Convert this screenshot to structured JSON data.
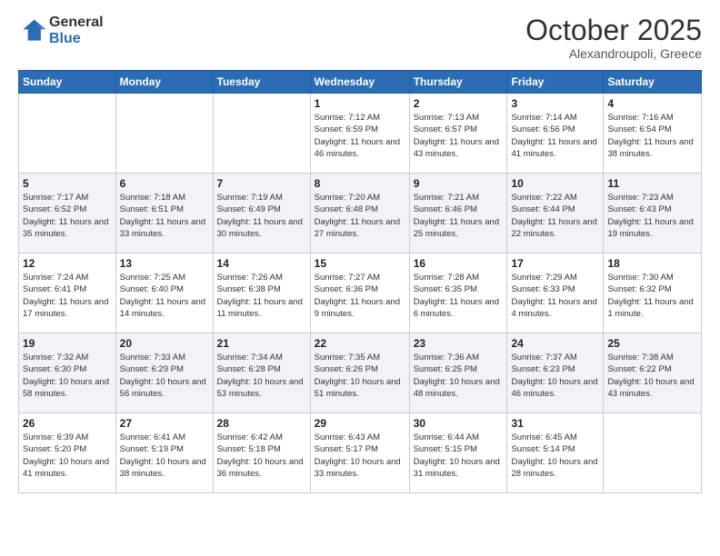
{
  "header": {
    "logo_general": "General",
    "logo_blue": "Blue",
    "month": "October 2025",
    "location": "Alexandroupoli, Greece"
  },
  "weekdays": [
    "Sunday",
    "Monday",
    "Tuesday",
    "Wednesday",
    "Thursday",
    "Friday",
    "Saturday"
  ],
  "weeks": [
    [
      {
        "day": "",
        "info": ""
      },
      {
        "day": "",
        "info": ""
      },
      {
        "day": "",
        "info": ""
      },
      {
        "day": "1",
        "info": "Sunrise: 7:12 AM\nSunset: 6:59 PM\nDaylight: 11 hours and 46 minutes."
      },
      {
        "day": "2",
        "info": "Sunrise: 7:13 AM\nSunset: 6:57 PM\nDaylight: 11 hours and 43 minutes."
      },
      {
        "day": "3",
        "info": "Sunrise: 7:14 AM\nSunset: 6:56 PM\nDaylight: 11 hours and 41 minutes."
      },
      {
        "day": "4",
        "info": "Sunrise: 7:16 AM\nSunset: 6:54 PM\nDaylight: 11 hours and 38 minutes."
      }
    ],
    [
      {
        "day": "5",
        "info": "Sunrise: 7:17 AM\nSunset: 6:52 PM\nDaylight: 11 hours and 35 minutes."
      },
      {
        "day": "6",
        "info": "Sunrise: 7:18 AM\nSunset: 6:51 PM\nDaylight: 11 hours and 33 minutes."
      },
      {
        "day": "7",
        "info": "Sunrise: 7:19 AM\nSunset: 6:49 PM\nDaylight: 11 hours and 30 minutes."
      },
      {
        "day": "8",
        "info": "Sunrise: 7:20 AM\nSunset: 6:48 PM\nDaylight: 11 hours and 27 minutes."
      },
      {
        "day": "9",
        "info": "Sunrise: 7:21 AM\nSunset: 6:46 PM\nDaylight: 11 hours and 25 minutes."
      },
      {
        "day": "10",
        "info": "Sunrise: 7:22 AM\nSunset: 6:44 PM\nDaylight: 11 hours and 22 minutes."
      },
      {
        "day": "11",
        "info": "Sunrise: 7:23 AM\nSunset: 6:43 PM\nDaylight: 11 hours and 19 minutes."
      }
    ],
    [
      {
        "day": "12",
        "info": "Sunrise: 7:24 AM\nSunset: 6:41 PM\nDaylight: 11 hours and 17 minutes."
      },
      {
        "day": "13",
        "info": "Sunrise: 7:25 AM\nSunset: 6:40 PM\nDaylight: 11 hours and 14 minutes."
      },
      {
        "day": "14",
        "info": "Sunrise: 7:26 AM\nSunset: 6:38 PM\nDaylight: 11 hours and 11 minutes."
      },
      {
        "day": "15",
        "info": "Sunrise: 7:27 AM\nSunset: 6:36 PM\nDaylight: 11 hours and 9 minutes."
      },
      {
        "day": "16",
        "info": "Sunrise: 7:28 AM\nSunset: 6:35 PM\nDaylight: 11 hours and 6 minutes."
      },
      {
        "day": "17",
        "info": "Sunrise: 7:29 AM\nSunset: 6:33 PM\nDaylight: 11 hours and 4 minutes."
      },
      {
        "day": "18",
        "info": "Sunrise: 7:30 AM\nSunset: 6:32 PM\nDaylight: 11 hours and 1 minute."
      }
    ],
    [
      {
        "day": "19",
        "info": "Sunrise: 7:32 AM\nSunset: 6:30 PM\nDaylight: 10 hours and 58 minutes."
      },
      {
        "day": "20",
        "info": "Sunrise: 7:33 AM\nSunset: 6:29 PM\nDaylight: 10 hours and 56 minutes."
      },
      {
        "day": "21",
        "info": "Sunrise: 7:34 AM\nSunset: 6:28 PM\nDaylight: 10 hours and 53 minutes."
      },
      {
        "day": "22",
        "info": "Sunrise: 7:35 AM\nSunset: 6:26 PM\nDaylight: 10 hours and 51 minutes."
      },
      {
        "day": "23",
        "info": "Sunrise: 7:36 AM\nSunset: 6:25 PM\nDaylight: 10 hours and 48 minutes."
      },
      {
        "day": "24",
        "info": "Sunrise: 7:37 AM\nSunset: 6:23 PM\nDaylight: 10 hours and 46 minutes."
      },
      {
        "day": "25",
        "info": "Sunrise: 7:38 AM\nSunset: 6:22 PM\nDaylight: 10 hours and 43 minutes."
      }
    ],
    [
      {
        "day": "26",
        "info": "Sunrise: 6:39 AM\nSunset: 5:20 PM\nDaylight: 10 hours and 41 minutes."
      },
      {
        "day": "27",
        "info": "Sunrise: 6:41 AM\nSunset: 5:19 PM\nDaylight: 10 hours and 38 minutes."
      },
      {
        "day": "28",
        "info": "Sunrise: 6:42 AM\nSunset: 5:18 PM\nDaylight: 10 hours and 36 minutes."
      },
      {
        "day": "29",
        "info": "Sunrise: 6:43 AM\nSunset: 5:17 PM\nDaylight: 10 hours and 33 minutes."
      },
      {
        "day": "30",
        "info": "Sunrise: 6:44 AM\nSunset: 5:15 PM\nDaylight: 10 hours and 31 minutes."
      },
      {
        "day": "31",
        "info": "Sunrise: 6:45 AM\nSunset: 5:14 PM\nDaylight: 10 hours and 28 minutes."
      },
      {
        "day": "",
        "info": ""
      }
    ]
  ]
}
